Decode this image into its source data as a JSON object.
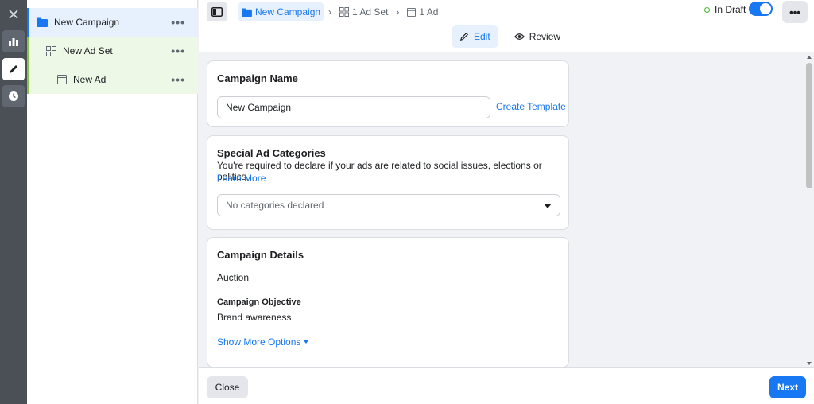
{
  "rail": {
    "items": [
      {
        "icon": "close-icon"
      },
      {
        "icon": "bar-chart-icon"
      },
      {
        "icon": "pencil-icon"
      },
      {
        "icon": "clock-icon"
      }
    ]
  },
  "tree": {
    "campaign": {
      "label": "New Campaign",
      "icon": "folder-icon"
    },
    "adset": {
      "label": "New Ad Set",
      "icon": "grid-icon"
    },
    "ad": {
      "label": "New Ad",
      "icon": "ad-icon"
    },
    "more_label": "•••"
  },
  "breadcrumbs": [
    {
      "label": "New Campaign",
      "icon": "folder-icon"
    },
    {
      "label": "1 Ad Set",
      "icon": "grid-icon"
    },
    {
      "label": "1 Ad",
      "icon": "ad-icon"
    }
  ],
  "status": {
    "label": "In Draft",
    "toggle_on": true
  },
  "more_label": "•••",
  "tabs": [
    {
      "label": "Edit",
      "icon": "pencil-icon",
      "active": true
    },
    {
      "label": "Review",
      "icon": "eye-icon",
      "active": false
    }
  ],
  "campaign_name": {
    "title": "Campaign Name",
    "value": "New Campaign",
    "template_link": "Create Template"
  },
  "special_ad": {
    "title": "Special Ad Categories",
    "description": "You're required to declare if your ads are related to social issues, elections or politics.",
    "learn_more": "Learn More",
    "select_value": "No categories declared"
  },
  "campaign_details": {
    "title": "Campaign Details",
    "buying_type": "Auction",
    "objective_label": "Campaign Objective",
    "objective_value": "Brand awareness",
    "show_more": "Show More Options"
  },
  "footer": {
    "close_label": "Close",
    "next_label": "Next"
  },
  "colors": {
    "accent": "#1877f2",
    "draft_dot": "#42b72a",
    "adset_bg": "#eef8e6",
    "campaign_bg": "#e7f0fd"
  }
}
